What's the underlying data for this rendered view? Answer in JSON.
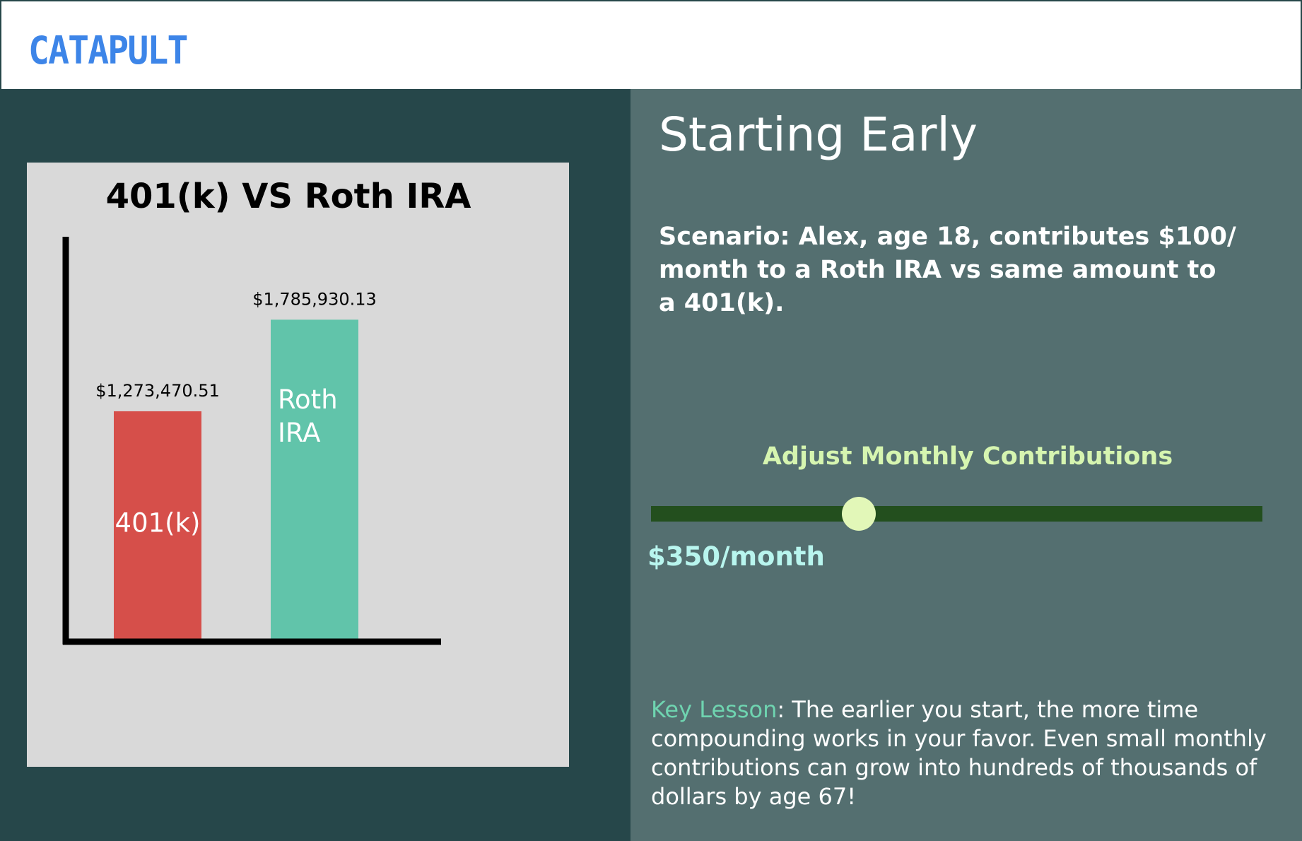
{
  "header": {
    "logo": "CATAPULT"
  },
  "colors": {
    "brand": "#3d85e8",
    "left_bg": "#26474a",
    "right_bg": "#546f70",
    "bar_401k": "#d64f4a",
    "bar_roth": "#61c4aa",
    "slider_track": "#234f1e",
    "slider_thumb": "#e2f7b8"
  },
  "chart_data": {
    "type": "bar",
    "title": "401(k) VS Roth IRA",
    "categories": [
      "401(k)",
      "Roth IRA"
    ],
    "bar_labels": [
      [
        "401(k)"
      ],
      [
        "Roth",
        "IRA"
      ]
    ],
    "values": [
      1273470.51,
      1785930.13
    ],
    "value_labels": [
      "$1,273,470.51",
      "$1,785,930.13"
    ],
    "ylim": [
      0,
      2250000
    ],
    "grid": false,
    "legend": "none"
  },
  "main": {
    "title": "Starting Early",
    "scenario": "Scenario: Alex, age 18, contributes $100/ month to a Roth IRA vs same amount to a 401(k).",
    "slider": {
      "label": "Adjust Monthly Contributions",
      "value_label": "$350/month",
      "level": 0.34
    },
    "lesson": {
      "key": "Key Lesson",
      "text": ": The earlier you start, the more time compounding works in your favor. Even small monthly contributions can grow into hundreds of thousands of dollars by age 67!"
    }
  }
}
